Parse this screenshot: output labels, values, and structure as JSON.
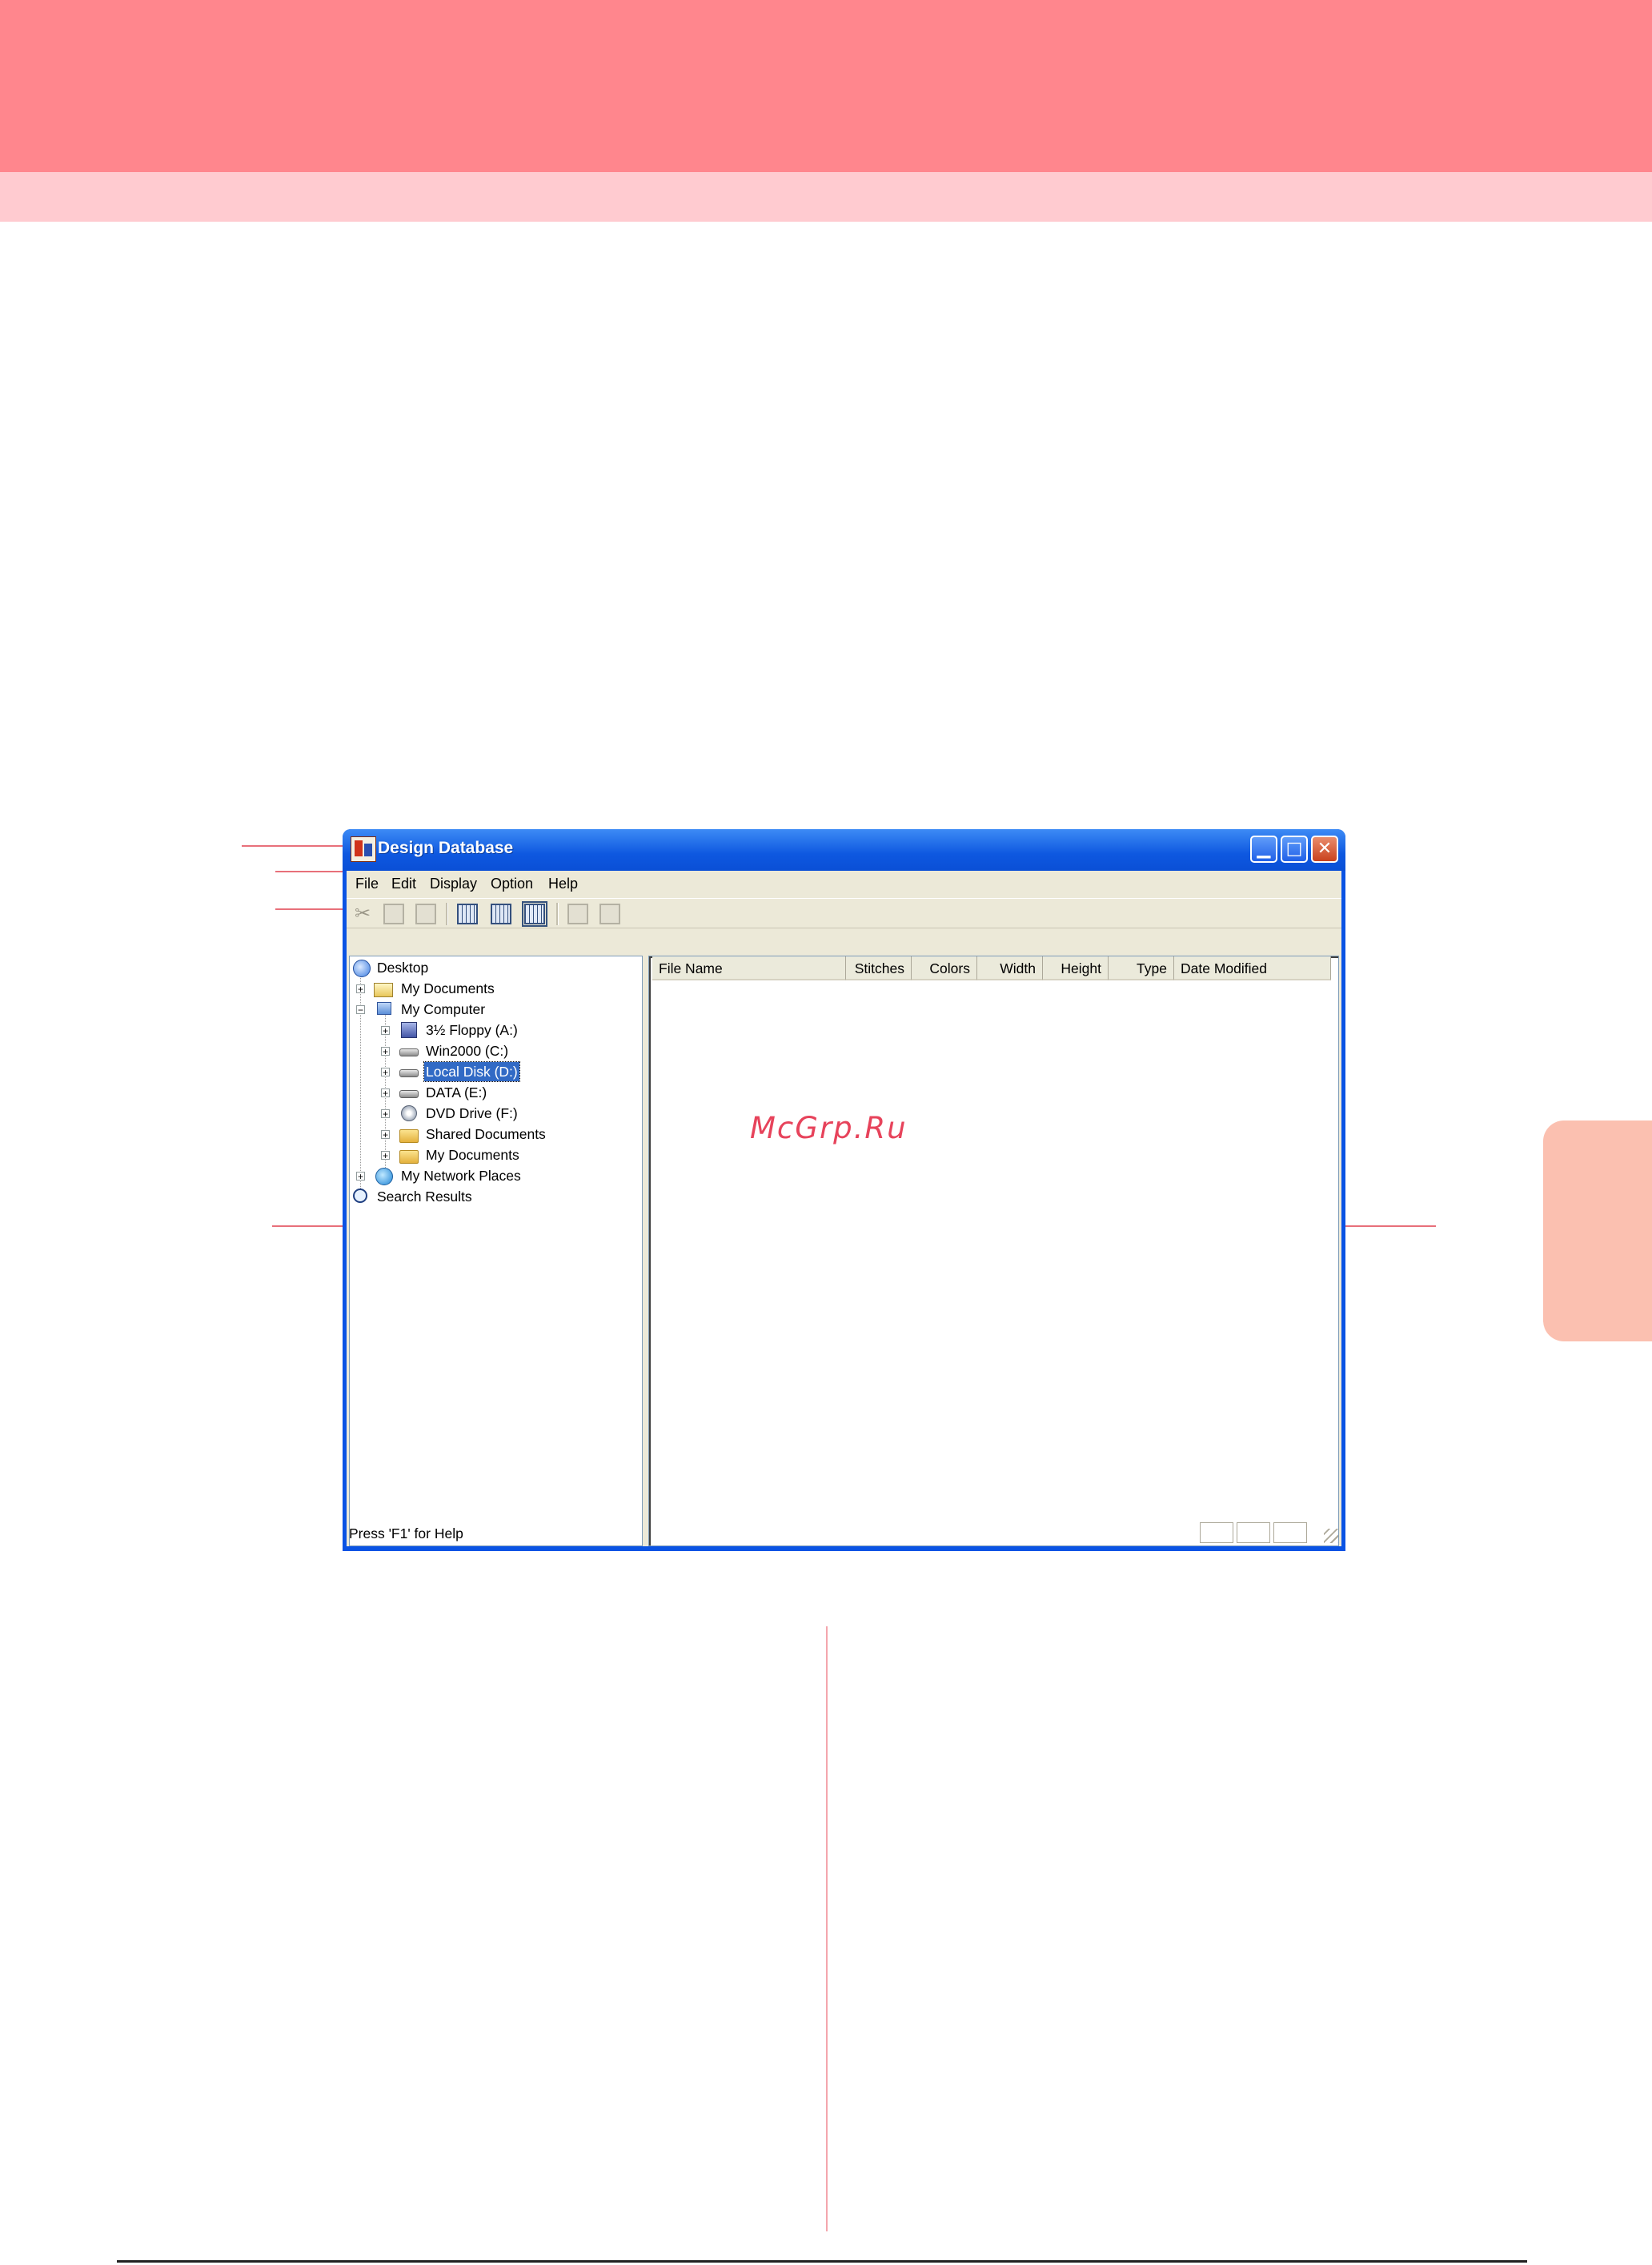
{
  "window": {
    "title": "Design Database",
    "controls": [
      "minimize",
      "maximize",
      "close"
    ]
  },
  "menu": [
    "File",
    "Edit",
    "Display",
    "Option",
    "Help"
  ],
  "toolbar": {
    "icons": [
      "cut-icon",
      "copy-icon",
      "paste-icon",
      "large-icons-view-icon",
      "list-view-icon",
      "details-view-icon",
      "properties-icon",
      "convert-icon"
    ]
  },
  "tree": {
    "nodes": [
      {
        "label": "Desktop"
      },
      {
        "label": "My Documents"
      },
      {
        "label": "My Computer"
      },
      {
        "label": "3½ Floppy (A:)"
      },
      {
        "label": "Win2000 (C:)"
      },
      {
        "label": "Local Disk (D:)",
        "selected": true
      },
      {
        "label": "DATA (E:)"
      },
      {
        "label": "DVD Drive (F:)"
      },
      {
        "label": "Shared Documents"
      },
      {
        "label": "My Documents"
      },
      {
        "label": "My Network Places"
      },
      {
        "label": "Search Results"
      }
    ]
  },
  "list": {
    "columns": [
      "File Name",
      "Stitches",
      "Colors",
      "Width",
      "Height",
      "Type",
      "Date Modified"
    ],
    "rows": []
  },
  "status": {
    "text": "Press 'F1' for Help"
  },
  "watermark": "McGrp.Ru",
  "colors": {
    "header_band": "#ff868d",
    "sub_band": "#ffcbd0",
    "side_tab": "#fbc0b0",
    "selection": "#316ac5",
    "window_frame": "#0a53e4"
  }
}
